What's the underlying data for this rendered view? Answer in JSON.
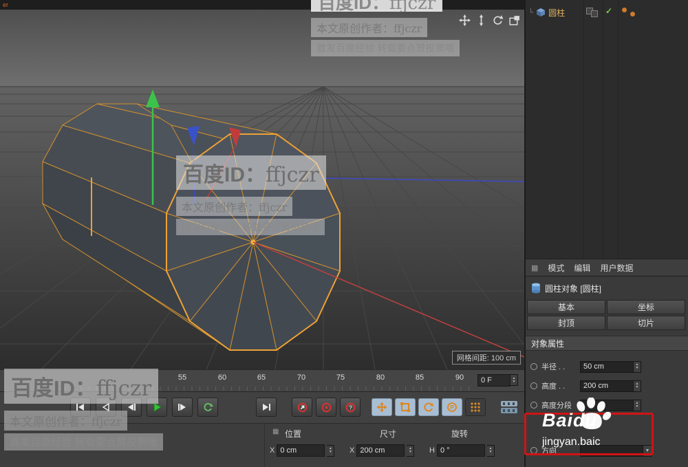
{
  "colors": {
    "selection_orange": "#f0a235",
    "axis_red": "#c04040",
    "axis_green": "#3cc24c",
    "axis_blue": "#3b49c9",
    "highlight_red": "#d11313",
    "play_green": "#35c23a",
    "icon_orange": "#e0861c"
  },
  "viewport": {
    "title_fragment": "er",
    "grid_badge": "网格间距: 100 cm"
  },
  "object_manager": {
    "item_label": "圆柱"
  },
  "attribute_manager": {
    "tab_mode": "模式",
    "tab_edit": "编辑",
    "tab_user": "用户数据",
    "object_title": "圆柱对象 [圆柱]",
    "btn_basic": "基本",
    "btn_coord": "坐标",
    "btn_caps": "封顶",
    "btn_slice": "切片",
    "section_title": "对象属性",
    "radius_label": "半径 . .",
    "radius_value": "50 cm",
    "height_label": "高度 . .",
    "height_value": "200 cm",
    "hseg_label": "高度分段",
    "orient_label": "方向"
  },
  "timeline": {
    "ticks": [
      "55",
      "60",
      "65",
      "70",
      "75",
      "80",
      "85",
      "90"
    ],
    "frame": "0 F"
  },
  "transport": {
    "question_glyph": "?",
    "p_glyph": "P"
  },
  "coords": {
    "pos": "位置",
    "size": "尺寸",
    "rot": "旋转",
    "f1_axis": "X",
    "f1_value": "0 cm",
    "f2_axis": "X",
    "f2_value": "200 cm",
    "f3_axis": "H",
    "f3_value": "0 °"
  },
  "watermark": {
    "id_prefix": "百度ID：",
    "id_name": "ffjczr",
    "author": "本文原创作者：ffjczr",
    "footer": "首发百度经验 转载要点赞投票哦",
    "logo": "Baidu",
    "logo_sub": "jingyan.baic"
  }
}
